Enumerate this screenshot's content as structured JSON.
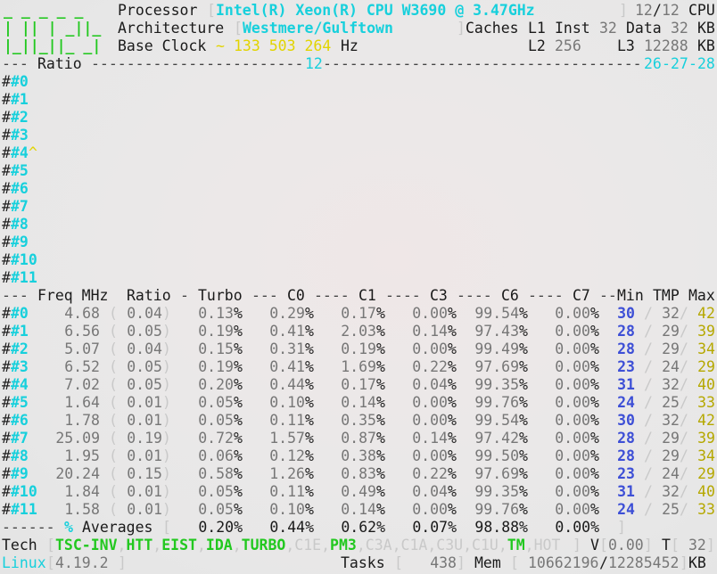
{
  "header": {
    "logo_lines": [
      "_ _ _ _ _",
      "| || | _||_",
      "|_||_||_ _|"
    ],
    "processor_label": "Processor",
    "processor_value": "Intel(R) Xeon(R) CPU W3690 @ 3.47GHz",
    "cpu_count": "12",
    "cpu_total": "12",
    "cpu_suffix": "CPU",
    "architecture_label": "Architecture",
    "architecture_value": "Westmere/Gulftown",
    "caches_label": "Caches",
    "l1_label": "L1",
    "inst_label": "Inst",
    "inst_value": "32",
    "data_label": "Data",
    "data_value": "32",
    "kb1": "KB",
    "base_clock_label": "Base Clock",
    "base_clock_prefix": "~",
    "base_clock_value": "133 503 264",
    "hz": "Hz",
    "l2_label": "L2",
    "l2_value": "256",
    "l3_label": "L3",
    "l3_value": "12288",
    "kb2": "KB"
  },
  "ratio_bar": {
    "title": "Ratio",
    "mark": "12",
    "marks_right": [
      "26",
      "27",
      "28"
    ]
  },
  "ratio_cores": [
    "#0",
    "#1",
    "#2",
    "#3",
    "#4",
    "#5",
    "#6",
    "#7",
    "#8",
    "#9",
    "#10",
    "#11"
  ],
  "ratio_cursor_core": 4,
  "ratio_cursor": "^",
  "table": {
    "headers": {
      "freq": "Freq MHz",
      "ratio": "Ratio",
      "turbo": "Turbo",
      "c0": "C0",
      "c1": "C1",
      "c3": "C3",
      "c6": "C6",
      "c7": "C7",
      "min": "Min",
      "tmp": "TMP",
      "max": "Max"
    },
    "rows": [
      {
        "core": "#0",
        "freq": "4.68",
        "ratio": "0.04",
        "turbo": "0.13",
        "c0": "0.29",
        "c1": "0.17",
        "c3": "0.00",
        "c6": "99.54",
        "c7": "0.00",
        "min": "30",
        "tmp": "32",
        "max": "42"
      },
      {
        "core": "#1",
        "freq": "6.56",
        "ratio": "0.05",
        "turbo": "0.19",
        "c0": "0.41",
        "c1": "2.03",
        "c3": "0.14",
        "c6": "97.43",
        "c7": "0.00",
        "min": "28",
        "tmp": "29",
        "max": "39"
      },
      {
        "core": "#2",
        "freq": "5.07",
        "ratio": "0.04",
        "turbo": "0.15",
        "c0": "0.31",
        "c1": "0.19",
        "c3": "0.00",
        "c6": "99.49",
        "c7": "0.00",
        "min": "28",
        "tmp": "29",
        "max": "34"
      },
      {
        "core": "#3",
        "freq": "6.52",
        "ratio": "0.05",
        "turbo": "0.19",
        "c0": "0.41",
        "c1": "1.69",
        "c3": "0.22",
        "c6": "97.69",
        "c7": "0.00",
        "min": "23",
        "tmp": "24",
        "max": "29"
      },
      {
        "core": "#4",
        "freq": "7.02",
        "ratio": "0.05",
        "turbo": "0.20",
        "c0": "0.44",
        "c1": "0.17",
        "c3": "0.04",
        "c6": "99.35",
        "c7": "0.00",
        "min": "31",
        "tmp": "32",
        "max": "40"
      },
      {
        "core": "#5",
        "freq": "1.64",
        "ratio": "0.01",
        "turbo": "0.05",
        "c0": "0.10",
        "c1": "0.14",
        "c3": "0.00",
        "c6": "99.76",
        "c7": "0.00",
        "min": "24",
        "tmp": "25",
        "max": "33"
      },
      {
        "core": "#6",
        "freq": "1.78",
        "ratio": "0.01",
        "turbo": "0.05",
        "c0": "0.11",
        "c1": "0.35",
        "c3": "0.00",
        "c6": "99.54",
        "c7": "0.00",
        "min": "30",
        "tmp": "32",
        "max": "42"
      },
      {
        "core": "#7",
        "freq": "25.09",
        "ratio": "0.19",
        "turbo": "0.72",
        "c0": "1.57",
        "c1": "0.87",
        "c3": "0.14",
        "c6": "97.42",
        "c7": "0.00",
        "min": "28",
        "tmp": "29",
        "max": "39"
      },
      {
        "core": "#8",
        "freq": "1.95",
        "ratio": "0.01",
        "turbo": "0.06",
        "c0": "0.12",
        "c1": "0.38",
        "c3": "0.00",
        "c6": "99.50",
        "c7": "0.00",
        "min": "28",
        "tmp": "29",
        "max": "34"
      },
      {
        "core": "#9",
        "freq": "20.24",
        "ratio": "0.15",
        "turbo": "0.58",
        "c0": "1.26",
        "c1": "0.83",
        "c3": "0.22",
        "c6": "97.69",
        "c7": "0.00",
        "min": "23",
        "tmp": "24",
        "max": "29"
      },
      {
        "core": "#10",
        "freq": "1.84",
        "ratio": "0.01",
        "turbo": "0.05",
        "c0": "0.11",
        "c1": "0.49",
        "c3": "0.04",
        "c6": "99.35",
        "c7": "0.00",
        "min": "31",
        "tmp": "32",
        "max": "40"
      },
      {
        "core": "#11",
        "freq": "1.58",
        "ratio": "0.01",
        "turbo": "0.05",
        "c0": "0.10",
        "c1": "0.14",
        "c3": "0.00",
        "c6": "99.76",
        "c7": "0.00",
        "min": "24",
        "tmp": "25",
        "max": "33"
      }
    ],
    "averages": {
      "pct_key": "%",
      "label": "Averages",
      "turbo": "0.20%",
      "c0": "0.44%",
      "c1": "0.62%",
      "c3": "0.07%",
      "c6": "98.88%",
      "c7": "0.00%"
    }
  },
  "tech": {
    "label": "Tech",
    "flags": [
      {
        "text": "TSC-INV",
        "on": true
      },
      {
        "text": "HTT",
        "on": true
      },
      {
        "text": "EIST",
        "on": true
      },
      {
        "text": "IDA",
        "on": true
      },
      {
        "text": "TURBO",
        "on": true
      },
      {
        "text": "C1E",
        "on": false
      },
      {
        "text": "PM3",
        "on": true
      },
      {
        "text": "C3A",
        "on": false
      },
      {
        "text": "C1A",
        "on": false
      },
      {
        "text": "C3U",
        "on": false
      },
      {
        "text": "C1U",
        "on": false
      },
      {
        "text": "TM",
        "on": true
      },
      {
        "text": "HOT",
        "on": false
      }
    ],
    "v_label": "V",
    "v_value": "0.00",
    "t_label": "T",
    "t_value": "32"
  },
  "status": {
    "os": "Linux",
    "kernel": "4.19.2",
    "tasks_label": "Tasks",
    "tasks_value": "438",
    "mem_label": "Mem",
    "mem_used": "10662196",
    "mem_total": "12285452",
    "mem_unit": "KB"
  },
  "colors": {
    "cyan": "#17d0dc",
    "green": "#22c81f",
    "yellow": "#e2d400",
    "blue": "#3d4fd6",
    "background": "#e9e9e9"
  }
}
